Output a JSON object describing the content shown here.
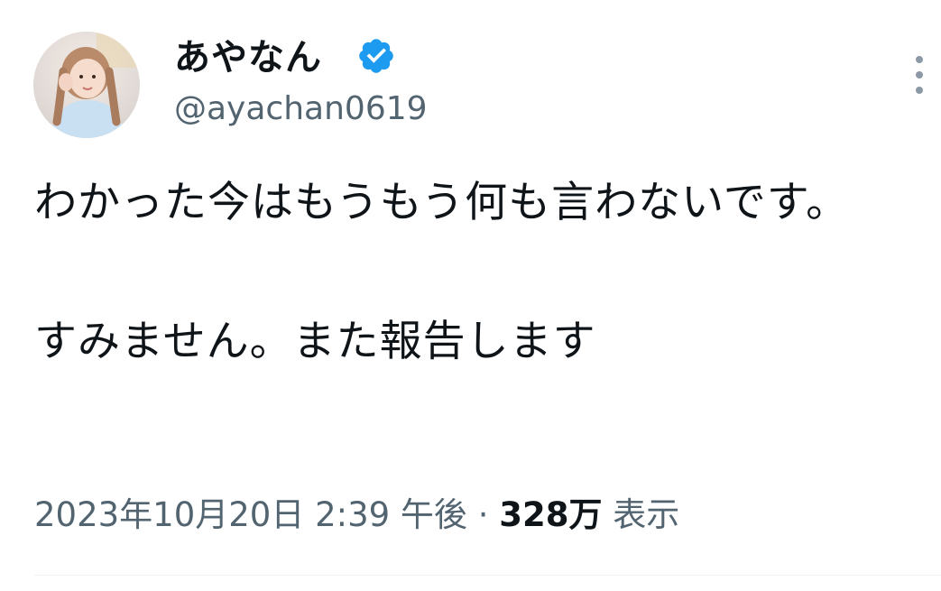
{
  "author": {
    "display_name": "あやなん",
    "handle": "@ayachan0619",
    "verified": true,
    "avatar_icon": "profile-photo"
  },
  "tweet": {
    "text": "わかった今はもうもう何も言わないです。\n\nすみません。また報告します"
  },
  "meta": {
    "timestamp": "2023年10月20日 2:39 午後",
    "separator": " · ",
    "views_count": "328万",
    "views_label": "表示"
  },
  "icons": {
    "verified": "verified-badge-icon",
    "more": "more-options-icon"
  },
  "colors": {
    "verified_blue": "#1d9bf0",
    "secondary_text": "#536471",
    "primary_text": "#0f1419"
  }
}
